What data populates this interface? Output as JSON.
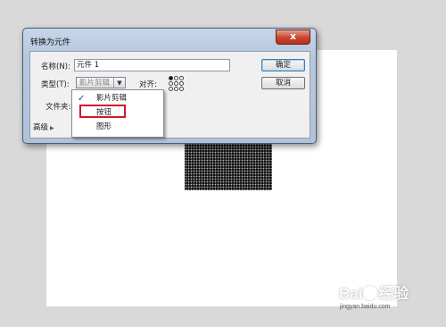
{
  "dialog": {
    "title": "转换为元件",
    "close_symbol": "x",
    "name_label": "名称(N):",
    "name_value": "元件 1",
    "type_label": "类型(T):",
    "type_selected": "影片剪辑",
    "align_label": "对齐:",
    "folder_label": "文件夹:",
    "advanced_label": "高级",
    "ok_label": "确定",
    "cancel_label": "取消"
  },
  "type_menu": {
    "items": [
      {
        "label": "影片剪辑",
        "checked": true
      },
      {
        "label": "按钮",
        "checked": false,
        "highlighted": true
      },
      {
        "label": "图形",
        "checked": false
      }
    ]
  },
  "registration": {
    "selected": "top-left"
  },
  "watermark": {
    "main_left": "Bai",
    "main_right": "经验",
    "sub": "jingyan.baidu.com"
  },
  "colors": {
    "stage": "#ffffff",
    "highlight": "#d1182a",
    "close_button": "#c9442e"
  }
}
